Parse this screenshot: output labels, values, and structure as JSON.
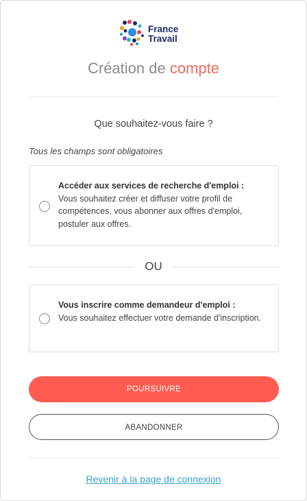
{
  "brand": {
    "logo_line1": "France",
    "logo_line2": "Travail"
  },
  "header": {
    "title_main": "Création de",
    "title_accent": "compte"
  },
  "form": {
    "question": "Que souhaitez-vous faire ?",
    "required_note": "Tous les champs sont obligatoires",
    "options": [
      {
        "title": "Accéder aux services de recherche d'emploi :",
        "description": "Vous souhaitez créer et diffuser votre profil de compétences, vous abonner aux offres d'emploi, postuler aux offres.",
        "selected": false
      },
      {
        "title": "Vous inscrire comme demandeur d'emploi :",
        "description": "Vous souhaitez effectuer votre demande d'inscription.",
        "selected": false
      }
    ],
    "separator": "OU"
  },
  "actions": {
    "continue_label": "POURSUIVRE",
    "cancel_label": "ABANDONNER"
  },
  "footer": {
    "back_link": "Revenir à la page de connexion"
  },
  "colors": {
    "accent": "#fe5c50",
    "title_accent": "#f26b5b",
    "link": "#3aa0c8",
    "brand_navy": "#1b2a6b"
  }
}
